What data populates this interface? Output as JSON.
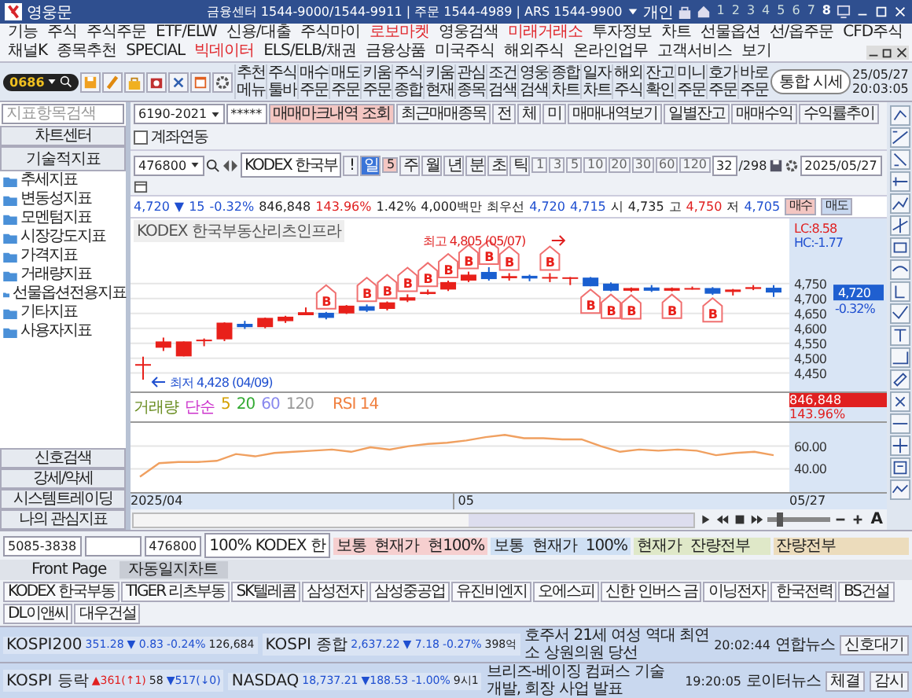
{
  "window": {
    "title": "영웅문",
    "hotline": "금융센터 1544-9000/1544-9911 | 주문 1544-4989 | ARS 1544-9900",
    "user": "개인",
    "screens": [
      {
        "label": "1",
        "selected": false
      },
      {
        "label": "2",
        "selected": false
      },
      {
        "label": "3",
        "selected": false
      },
      {
        "label": "4",
        "selected": false
      },
      {
        "label": "5",
        "selected": false
      },
      {
        "label": "6",
        "selected": false
      },
      {
        "label": "7",
        "selected": false
      },
      {
        "label": "8",
        "selected": true
      }
    ]
  },
  "menu": [
    {
      "label": "기능",
      "highlight": false
    },
    {
      "label": "주식",
      "highlight": false
    },
    {
      "label": "주식주문",
      "highlight": false
    },
    {
      "label": "ETF/ELW",
      "highlight": false
    },
    {
      "label": "신용/대출",
      "highlight": false
    },
    {
      "label": "주식마이",
      "highlight": false
    },
    {
      "label": "로보마켓",
      "highlight": true
    },
    {
      "label": "영웅검색",
      "highlight": false
    },
    {
      "label": "미래거래소",
      "highlight": true
    },
    {
      "label": "투자정보",
      "highlight": false
    },
    {
      "label": "차트",
      "highlight": false
    },
    {
      "label": "선물옵션",
      "highlight": false
    },
    {
      "label": "선/옵주문",
      "highlight": false
    },
    {
      "label": "CFD주식",
      "highlight": false
    },
    {
      "label": "채널K",
      "highlight": false
    },
    {
      "label": "종목추천",
      "highlight": false
    },
    {
      "label": "SPECIAL",
      "highlight": false
    },
    {
      "label": "빅데이터",
      "highlight": true
    },
    {
      "label": "ELS/ELB/채권",
      "highlight": false
    },
    {
      "label": "금융상품",
      "highlight": false
    },
    {
      "label": "미국주식",
      "highlight": false
    },
    {
      "label": "해외주식",
      "highlight": false
    },
    {
      "label": "온라인업무",
      "highlight": false
    },
    {
      "label": "고객서비스",
      "highlight": false
    },
    {
      "label": "보기",
      "highlight": false
    }
  ],
  "toolbar": {
    "screen_number": "0686",
    "tools": [
      "추천 메뉴",
      "주식 툴바",
      "매수 주문",
      "매도 주문",
      "키움 주문",
      "주식 종합",
      "키움 현재",
      "관심 종목",
      "조건 검색",
      "영웅 검색",
      "종합 차트",
      "일자 차트",
      "해외 주식",
      "잔고 확인",
      "미니 주문",
      "호가 주문",
      "바로 주문"
    ],
    "search": "통합 시세",
    "date": "25/05/27",
    "time": "20:03:05"
  },
  "indicator_panel": {
    "search_placeholder": "지표항목검색",
    "center_button": "차트센터",
    "header": "기술적지표",
    "folders": [
      "추세지표",
      "변동성지표",
      "모멘텀지표",
      "시장강도지표",
      "가격지표",
      "거래량지표",
      "선물옵션전용지표",
      "기타지표",
      "사용자지표"
    ],
    "buttons": [
      "신호검색",
      "강세/약세",
      "시스템트레이딩",
      "나의 관심지표"
    ]
  },
  "account_bar": {
    "account": "6190-2021",
    "password": "*****",
    "buttons": [
      {
        "label": "매매마크내역 조회",
        "kind": "primary"
      },
      {
        "label": "최근매매종목",
        "kind": "normal"
      },
      {
        "label": "전",
        "kind": "normal"
      },
      {
        "label": "체",
        "kind": "normal"
      },
      {
        "label": "미",
        "kind": "normal"
      },
      {
        "label": "매매내역보기",
        "kind": "normal"
      },
      {
        "label": "일별잔고",
        "kind": "normal"
      },
      {
        "label": "매매수익",
        "kind": "normal"
      },
      {
        "label": "수익률추이",
        "kind": "normal"
      }
    ],
    "link_checkbox": {
      "label": "계좌연동",
      "checked": false
    }
  },
  "chart_toolbar": {
    "code": "476800",
    "name": "KODEX 한국부",
    "alert": "!",
    "periods": [
      {
        "label": "일",
        "selected": true
      },
      {
        "label": "주",
        "selected": false
      },
      {
        "label": "월",
        "selected": false
      },
      {
        "label": "년",
        "selected": false
      },
      {
        "label": "분",
        "selected": false
      },
      {
        "label": "초",
        "selected": false
      },
      {
        "label": "틱",
        "selected": false
      }
    ],
    "multiplier": "5",
    "intervals": [
      "1",
      "3",
      "5",
      "10",
      "20",
      "30",
      "60",
      "120"
    ],
    "count": "32",
    "total": "/298",
    "date": "2025/05/27"
  },
  "quote": {
    "price": "4,720",
    "direction": "▼",
    "change": "15",
    "rate": "-0.32%",
    "volume": "846,848",
    "volume_ratio": "143.96%",
    "turnover": "1.42%",
    "amount": "4,000백만",
    "best_label": "최우선",
    "ask": "4,720",
    "bid": "4,715",
    "open_label": "시",
    "open": "4,735",
    "high_label": "고",
    "high": "4,750",
    "low_label": "저",
    "low": "4,705",
    "buy": "매수",
    "sell": "매도"
  },
  "chart": {
    "title": "KODEX 한국부동산리츠인프라",
    "high_note": "최고 4,805 (05/07)",
    "low_note": "최저 4,428 (04/09)",
    "lc": "LC:8.58",
    "hc": "HC:-1.77",
    "price_ticks": [
      "4,750",
      "4,700",
      "4,650",
      "4,600",
      "4,550",
      "4,500",
      "4,450"
    ],
    "last_price": "4,720",
    "last_rate": "-0.32%",
    "trade_marks": [
      "B",
      "B",
      "B",
      "B",
      "B",
      "B",
      "B",
      "B",
      "B",
      "B",
      "B",
      "B",
      "B",
      "B",
      "B"
    ],
    "volume_legend": [
      {
        "label": "거래량",
        "color": "#6b8e23"
      },
      {
        "label": "단순",
        "color": "#cc33cc"
      },
      {
        "label": "5",
        "color": "#d4a000"
      },
      {
        "label": "20",
        "color": "#33aa33"
      },
      {
        "label": "60",
        "color": "#8888ee"
      },
      {
        "label": "120",
        "color": "#999999"
      }
    ],
    "volume": "846,848",
    "volume_rate": "143.96%",
    "rsi_legend": "RSI 14",
    "rsi_ticks": [
      "60.00",
      "40.00"
    ],
    "x_labels": [
      "2025/04",
      "05",
      "05/27"
    ],
    "zoom_slider": {
      "level": 0.15
    },
    "font_button": "A"
  },
  "order_bar": {
    "account": "5085-3838",
    "code": "476800",
    "name": "100% KODEX 한",
    "actions": [
      {
        "label": "보통  현재가  현100%",
        "color": "#f6cfcf"
      },
      {
        "label": "보통  현재가  100%",
        "color": "#cfe0f4"
      },
      {
        "label": "현재가  잔량전부",
        "color": "#dfe8c8"
      },
      {
        "label": "잔량전부",
        "color": "#ecdcbc"
      }
    ]
  },
  "tabs": [
    {
      "label": "Front Page",
      "selected": false
    },
    {
      "label": "자동일지차트",
      "selected": true
    }
  ],
  "watchlist": [
    "KODEX 한국부동",
    "TIGER 리츠부동",
    "SK텔레콤",
    "삼성전자",
    "삼성중공업",
    "유진비엔지",
    "오에스피",
    "신한 인버스 금",
    "이닝전자",
    "한국전력",
    "BS건설",
    "DL이앤씨",
    "대우건설"
  ],
  "market": [
    {
      "blocks": [
        {
          "name": "KOSPI200",
          "cells": [
            {
              "text": "351.28",
              "color": "#1f4fd0"
            },
            {
              "text": "▼ 0.83",
              "color": "#1f4fd0"
            },
            {
              "text": "-0.24%",
              "color": "#1f4fd0"
            },
            {
              "text": "126,684",
              "color": "#222222"
            }
          ]
        },
        {
          "name": "KOSPI 종합",
          "cells": [
            {
              "text": "2,637.22",
              "color": "#1f4fd0"
            },
            {
              "text": "▼ 7.18",
              "color": "#1f4fd0"
            },
            {
              "text": "-0.27%",
              "color": "#1f4fd0"
            },
            {
              "text": "398억",
              "color": "#222222"
            }
          ]
        }
      ],
      "headline": "호주서 21세 여성 역대 최연소 상원의원 당선",
      "time": "20:02:44",
      "source": "연합뉴스",
      "buttons": [
        "신호대기"
      ]
    },
    {
      "blocks": [
        {
          "name": "KOSPI 등락",
          "cells": [
            {
              "text": "▲361(↑1)",
              "color": "#e02020"
            },
            {
              "text": "58",
              "color": "#222222"
            },
            {
              "text": "▼517(↓0)",
              "color": "#1f4fd0"
            }
          ]
        },
        {
          "name": "NASDAQ",
          "cells": [
            {
              "text": "18,737.21",
              "color": "#1f4fd0"
            },
            {
              "text": "▼188.53",
              "color": "#1f4fd0"
            },
            {
              "text": "-1.00%",
              "color": "#1f4fd0"
            },
            {
              "text": "9시1",
              "color": "#222222"
            }
          ]
        }
      ],
      "headline": "브리즈-베이징 컴퍼스 기술 개발, 회장 사업 발표",
      "time": "19:20:05",
      "source": "로이터뉴스",
      "buttons": [
        "체결",
        "감시"
      ]
    }
  ]
}
